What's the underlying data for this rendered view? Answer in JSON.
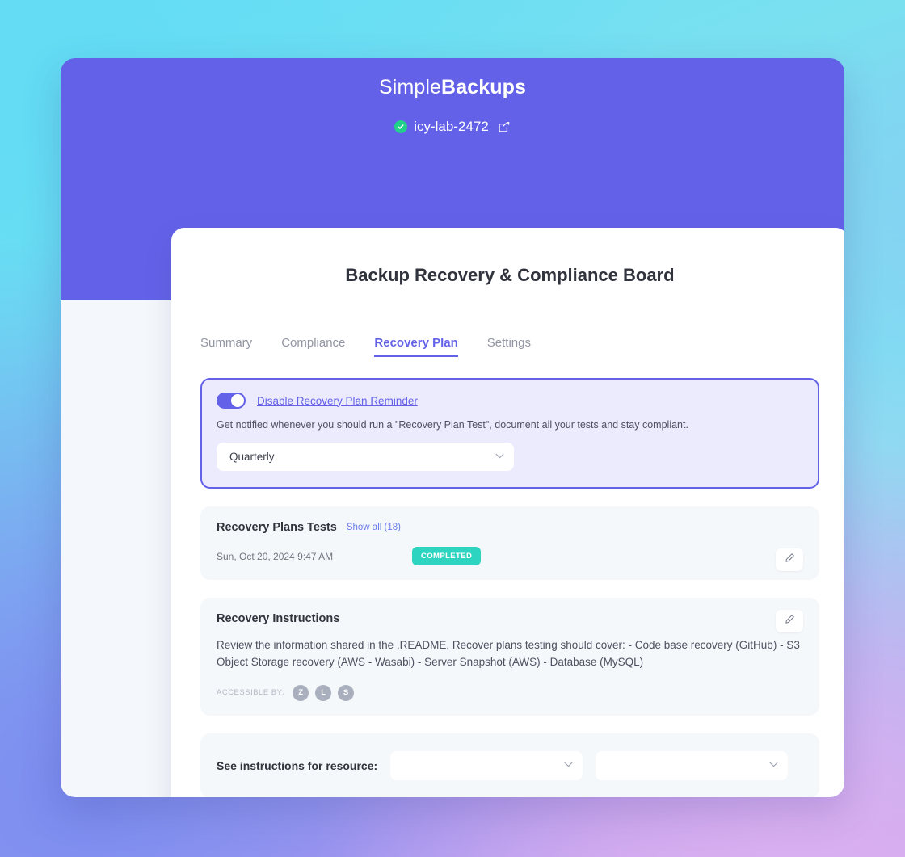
{
  "brand": {
    "light_part": "Simple",
    "bold_part": "Backups"
  },
  "workspace": {
    "name": "icy-lab-2472",
    "verified_icon": "check-circle-icon",
    "share_icon": "external-link-icon"
  },
  "page": {
    "title": "Backup Recovery & Compliance Board"
  },
  "tabs": [
    {
      "label": "Summary",
      "active": false
    },
    {
      "label": "Compliance",
      "active": false
    },
    {
      "label": "Recovery Plan",
      "active": true
    },
    {
      "label": "Settings",
      "active": false
    }
  ],
  "reminder": {
    "toggle_state": "on",
    "link_label": "Disable Recovery Plan Reminder",
    "description": "Get notified whenever you should run a \"Recovery Plan Test\", document all your tests and stay compliant.",
    "frequency_value": "Quarterly",
    "chevron_icon": "chevron-down-icon"
  },
  "tests": {
    "title": "Recovery Plans Tests",
    "show_all_label": "Show all (18)",
    "rows": [
      {
        "date": "Sun, Oct 20, 2024 9:47 AM",
        "status": "COMPLETED"
      }
    ],
    "edit_icon": "pencil-icon"
  },
  "instructions": {
    "title": "Recovery Instructions",
    "body": "Review the information shared in the .README. Recover plans testing should cover: - Code base recovery (GitHub) - S3 Object Storage recovery (AWS - Wasabi) - Server Snapshot (AWS) - Database (MySQL)",
    "accessible_label": "ACCESSIBLE BY:",
    "avatars": [
      "Z",
      "L",
      "S"
    ],
    "edit_icon": "pencil-icon"
  },
  "resource": {
    "label": "See instructions for resource:",
    "select_one_value": "",
    "select_two_value": "",
    "chevron_icon": "chevron-down-icon"
  },
  "colors": {
    "brand_purple": "#6361e8",
    "status_teal": "#2dd4bf",
    "verified_green": "#21d08a",
    "card_bg": "#f5f8fb",
    "reminder_bg": "#eceafd"
  }
}
